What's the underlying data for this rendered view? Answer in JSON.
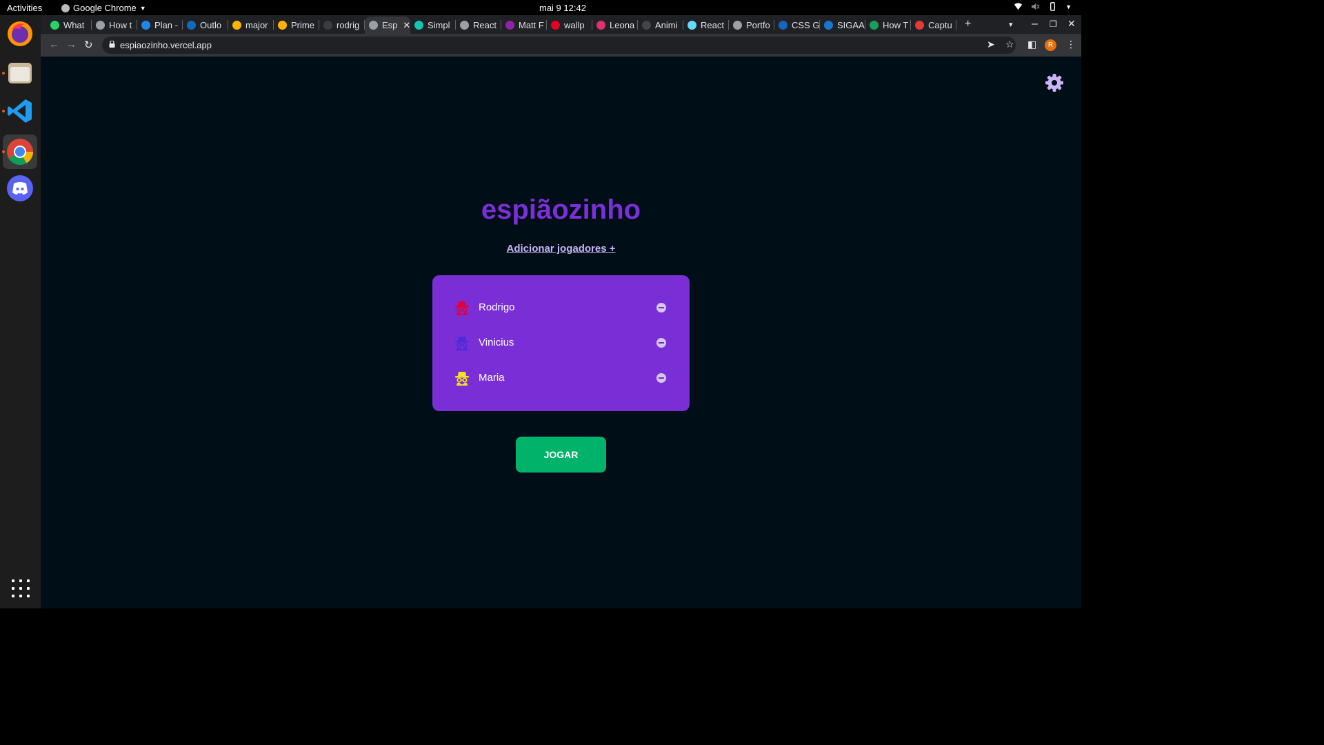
{
  "system": {
    "activities": "Activities",
    "app_name": "Google Chrome",
    "clock": "mai 9  12:42"
  },
  "browser": {
    "tabs": [
      {
        "label": "What",
        "color": "#25d366"
      },
      {
        "label": "How t",
        "color": "#9aa0a6"
      },
      {
        "label": "Plan -",
        "color": "#1e88e5"
      },
      {
        "label": "Outlo",
        "color": "#0f6cbd"
      },
      {
        "label": "major",
        "color": "#ffb300"
      },
      {
        "label": "Prime",
        "color": "#ffb300"
      },
      {
        "label": "rodrig",
        "color": "#3c3c3c"
      },
      {
        "label": "Esp",
        "color": "#9aa0a6",
        "active": true
      },
      {
        "label": "Simpl",
        "color": "#17c3b2"
      },
      {
        "label": "React",
        "color": "#9aa0a6"
      },
      {
        "label": "Matt F",
        "color": "#8e24aa"
      },
      {
        "label": "wallp",
        "color": "#e60023"
      },
      {
        "label": "Leona",
        "color": "#e1306c"
      },
      {
        "label": "Animi",
        "color": "#444444"
      },
      {
        "label": "React",
        "color": "#61dafb"
      },
      {
        "label": "Portfo",
        "color": "#9aa0a6"
      },
      {
        "label": "CSS G",
        "color": "#1565c0"
      },
      {
        "label": "SIGAA",
        "color": "#1976d2"
      },
      {
        "label": "How T",
        "color": "#18a058"
      },
      {
        "label": "Captu",
        "color": "#e53935"
      }
    ],
    "new_tab": "+",
    "url": "espiaozinho.vercel.app",
    "profile_initial": "R"
  },
  "page": {
    "title": "espiãozinho",
    "add_players_link": "Adicionar jogadores +",
    "players": [
      {
        "name": "Rodrigo",
        "color": "#e0003a"
      },
      {
        "name": "Vinicius",
        "color": "#4c2bd9"
      },
      {
        "name": "Maria",
        "color": "#f2e31a"
      }
    ],
    "play_button": "JOGAR"
  },
  "colors": {
    "page_background": "#000e18",
    "title": "#7b2fd8",
    "card": "#7a2fd6",
    "play_button": "#01b26b",
    "settings_icon": "#c9b5f5"
  }
}
